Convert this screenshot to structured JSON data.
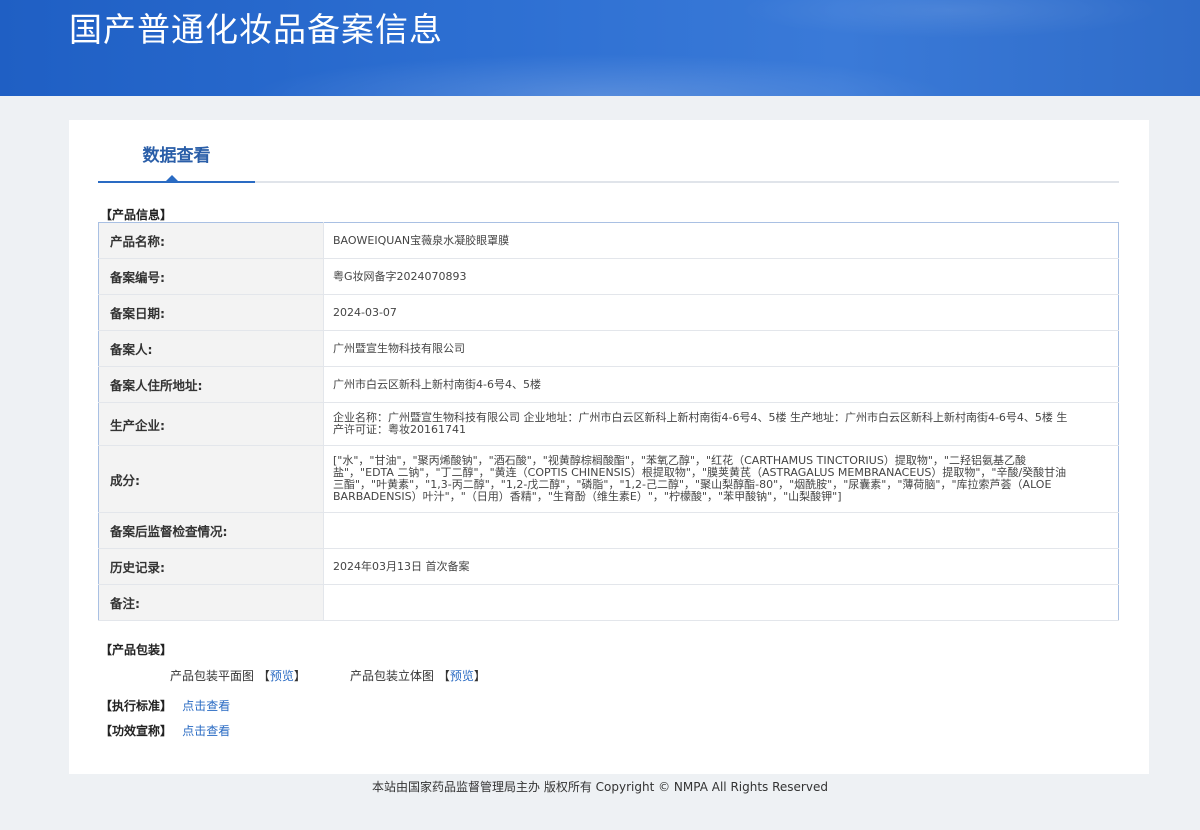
{
  "header": {
    "title": "国产普通化妆品备案信息"
  },
  "tab": {
    "label": "数据查看"
  },
  "sections": {
    "product_info": "【产品信息】",
    "package": "【产品包装】",
    "standard": "【执行标准】",
    "efficacy": "【功效宣称】"
  },
  "rows": [
    {
      "key": "产品名称:",
      "value": "BAOWEIQUAN宝薇泉水凝胶眼罩膜"
    },
    {
      "key": "备案编号:",
      "value": "粤G妆网备字2024070893"
    },
    {
      "key": "备案日期:",
      "value": "2024-03-07"
    },
    {
      "key": "备案人:",
      "value": "广州暨宣生物科技有限公司"
    },
    {
      "key": "备案人住所地址:",
      "value": "广州市白云区新科上新村南街4-6号4、5楼"
    },
    {
      "key": "生产企业:",
      "value": "企业名称：广州暨宣生物科技有限公司 企业地址：广州市白云区新科上新村南街4-6号4、5楼 生产地址：广州市白云区新科上新村南街4-6号4、5楼 生产许可证：粤妆20161741"
    },
    {
      "key": "成分:",
      "value": "[\"水\"，\"甘油\"，\"聚丙烯酸钠\"，\"酒石酸\"，\"视黄醇棕榈酸酯\"，\"苯氧乙醇\"，\"红花（CARTHAMUS TINCTORIUS）提取物\"，\"二羟铝氨基乙酸盐\"，\"EDTA 二钠\"，\"丁二醇\"，\"黄连（COPTIS CHINENSIS）根提取物\"，\"膜荚黄芪（ASTRAGALUS MEMBRANACEUS）提取物\"，\"辛酸/癸酸甘油三酯\"，\"叶黄素\"，\"1,3-丙二醇\"，\"1,2-戊二醇\"，\"磷脂\"，\"1,2-己二醇\"，\"聚山梨醇酯-80\"，\"烟酰胺\"，\"尿囊素\"，\"薄荷脑\"，\"库拉索芦荟（ALOE BARBADENSIS）叶汁\"，\"（日用）香精\"，\"生育酚（维生素E）\"，\"柠檬酸\"，\"苯甲酸钠\"，\"山梨酸钾\"]"
    },
    {
      "key": "备案后监督检查情况:",
      "value": ""
    },
    {
      "key": "历史记录:",
      "value": "2024年03月13日 首次备案"
    },
    {
      "key": "备注:",
      "value": ""
    }
  ],
  "package": {
    "flat_label": "产品包装平面图",
    "solid_label": "产品包装立体图",
    "bracket_open": "【",
    "bracket_close": "】",
    "preview": "预览"
  },
  "links": {
    "view": "点击查看"
  },
  "footer": {
    "text": "本站由国家药品监督管理局主办 版权所有 Copyright © NMPA All Rights Reserved"
  }
}
